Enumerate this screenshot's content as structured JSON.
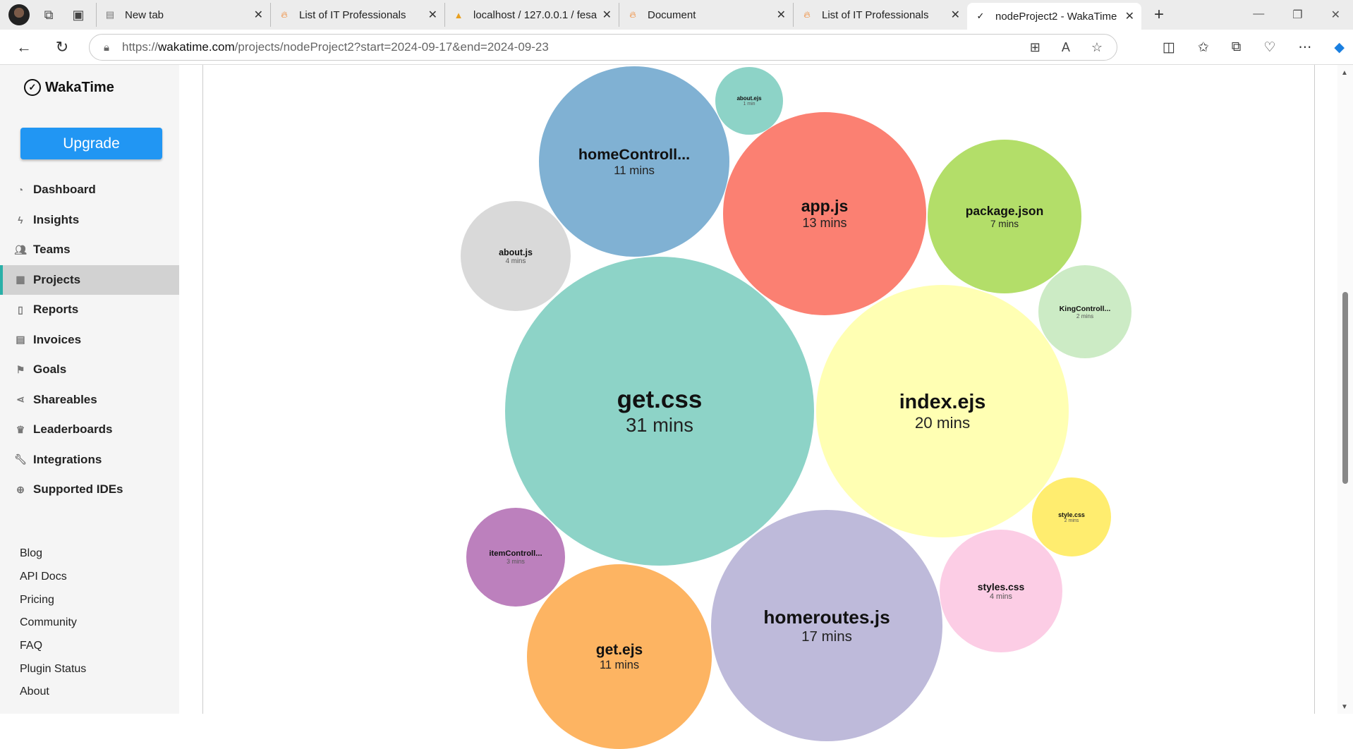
{
  "browser": {
    "tabs": [
      {
        "label": "New tab",
        "icon": "newtab-icon"
      },
      {
        "label": "List of IT Professionals",
        "icon": "flame-icon"
      },
      {
        "label": "localhost / 127.0.0.1 / fesa",
        "icon": "pma-icon"
      },
      {
        "label": "Document",
        "icon": "flame-icon"
      },
      {
        "label": "List of IT Professionals",
        "icon": "flame-icon"
      },
      {
        "label": "nodeProject2 - WakaTime",
        "icon": "wakatime-icon"
      }
    ],
    "url_scheme": "https://",
    "url_host": "wakatime.com",
    "url_path": "/projects/nodeProject2?start=2024-09-17&end=2024-09-23"
  },
  "sidebar": {
    "logo": "WakaTime",
    "upgrade": "Upgrade",
    "items": [
      {
        "label": "Dashboard",
        "icon": "dashboard-icon"
      },
      {
        "label": "Insights",
        "icon": "bolt-icon"
      },
      {
        "label": "Teams",
        "icon": "users-icon"
      },
      {
        "label": "Projects",
        "icon": "grid-icon"
      },
      {
        "label": "Reports",
        "icon": "pdf-icon"
      },
      {
        "label": "Invoices",
        "icon": "file-icon"
      },
      {
        "label": "Goals",
        "icon": "flag-icon"
      },
      {
        "label": "Shareables",
        "icon": "share-icon"
      },
      {
        "label": "Leaderboards",
        "icon": "trophy-icon"
      },
      {
        "label": "Integrations",
        "icon": "wrench-icon"
      },
      {
        "label": "Supported IDEs",
        "icon": "plus-circle-icon"
      }
    ],
    "footer": [
      "Blog",
      "API Docs",
      "Pricing",
      "Community",
      "FAQ",
      "Plugin Status",
      "About"
    ]
  },
  "chart_data": {
    "type": "bubble",
    "unit": "mins",
    "items": [
      {
        "name": "homeControll...",
        "value": 11,
        "label": "11 mins",
        "color": "#80b1d3"
      },
      {
        "name": "about.ejs",
        "value": 1,
        "label": "1 min",
        "color": "#8dd3c7"
      },
      {
        "name": "app.js",
        "value": 13,
        "label": "13 mins",
        "color": "#fb8072"
      },
      {
        "name": "package.json",
        "value": 7,
        "label": "7 mins",
        "color": "#b3de69"
      },
      {
        "name": "about.js",
        "value": 4,
        "label": "4 mins",
        "color": "#d9d9d9"
      },
      {
        "name": "KingControll...",
        "value": 2,
        "label": "2 mins",
        "color": "#ccebc5"
      },
      {
        "name": "get.css",
        "value": 31,
        "label": "31 mins",
        "color": "#8dd3c7"
      },
      {
        "name": "index.ejs",
        "value": 20,
        "label": "20 mins",
        "color": "#ffffb3"
      },
      {
        "name": "style.css",
        "value": 2,
        "label": "2 mins",
        "color": "#ffed6f"
      },
      {
        "name": "itemControll...",
        "value": 3,
        "label": "3 mins",
        "color": "#bc80bd"
      },
      {
        "name": "styles.css",
        "value": 4,
        "label": "4 mins",
        "color": "#fccde5"
      },
      {
        "name": "homeroutes.js",
        "value": 17,
        "label": "17 mins",
        "color": "#bebada"
      },
      {
        "name": "get.ejs",
        "value": 11,
        "label": "11 mins",
        "color": "#fdb462"
      }
    ]
  }
}
